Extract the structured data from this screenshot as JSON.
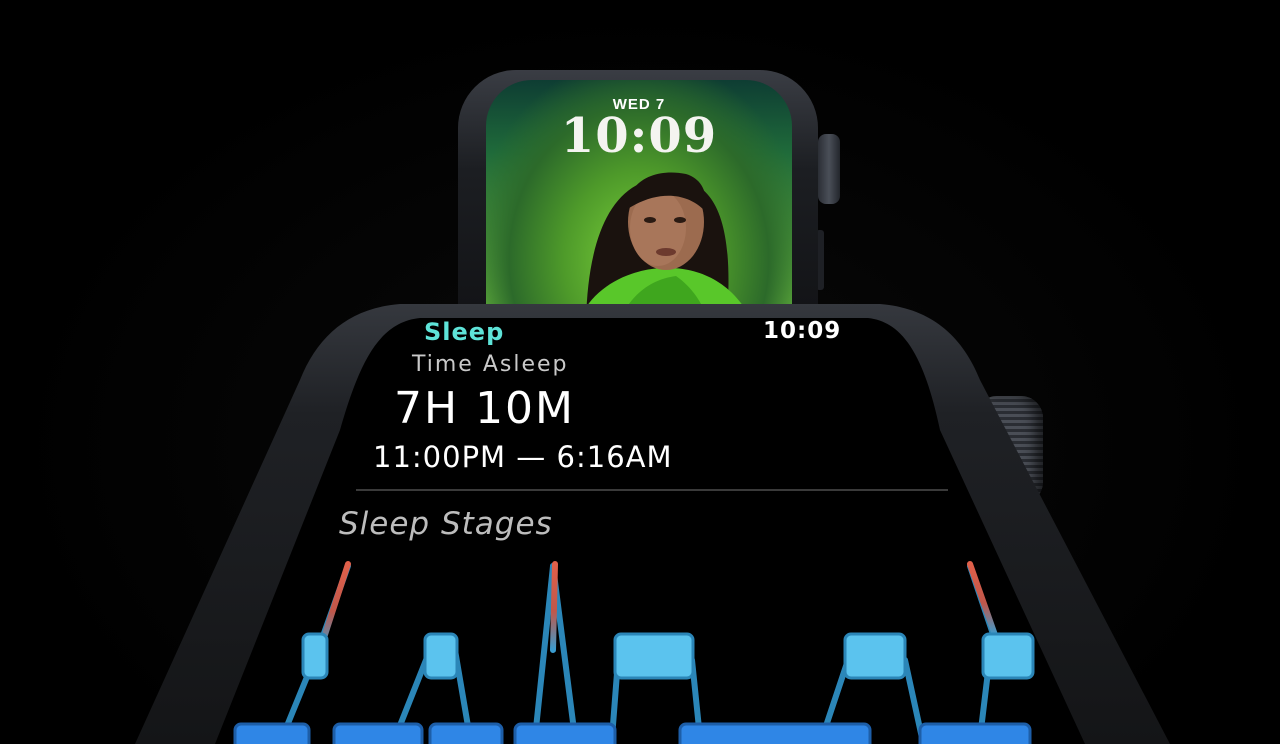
{
  "back_watch": {
    "date": "WED 7",
    "time": "10:09"
  },
  "sleep_app": {
    "title": "Sleep",
    "status_time": "10:09",
    "time_asleep_label": "Time Asleep",
    "time_asleep_value": "7H 10M",
    "time_range": "11:00PM — 6:16AM",
    "stages_title": "Sleep Stages"
  },
  "colors": {
    "accent_teal": "#5ee3d8",
    "awake": "#e0604a",
    "rem": "#5bc3ee",
    "core": "#2f86e6",
    "connector": "#3a9ccf"
  },
  "icons": [
    "digital-crown-icon"
  ]
}
